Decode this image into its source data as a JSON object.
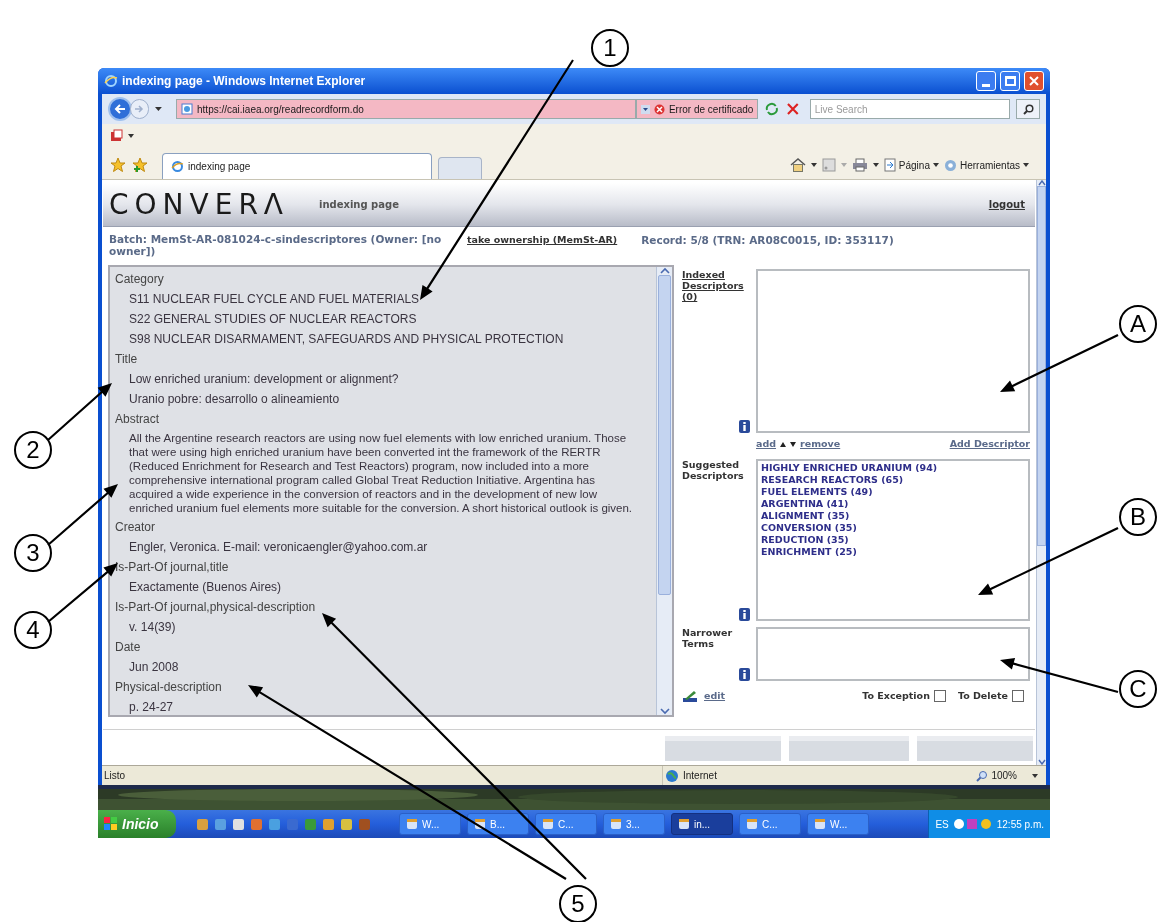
{
  "callouts": [
    {
      "label": "1"
    },
    {
      "label": "2"
    },
    {
      "label": "3"
    },
    {
      "label": "4"
    },
    {
      "label": "5"
    },
    {
      "label": "A"
    },
    {
      "label": "B"
    },
    {
      "label": "C"
    }
  ],
  "window": {
    "title": "indexing page - Windows Internet Explorer"
  },
  "address_bar": {
    "url": "https://cai.iaea.org/readrecordform.do",
    "certificate_error": "Error de certificado"
  },
  "search": {
    "placeholder": "Live Search"
  },
  "tabs": [
    {
      "label": "indexing page",
      "selected": true
    }
  ],
  "command_bar": [
    "Página",
    "Herramientas"
  ],
  "page": {
    "logo": "CONVERΛ",
    "title": "indexing page",
    "logout": "logout",
    "batch": "Batch: MemSt-AR-081024-c-sindescriptores (Owner: [no owner])",
    "take_ownership": "take ownership (MemSt-AR)",
    "record": "Record: 5/8 (TRN: AR08C0015, ID: 353117)"
  },
  "record_fields": [
    {
      "label": "Category",
      "values": [
        "S11 NUCLEAR FUEL CYCLE AND FUEL MATERIALS",
        "S22 GENERAL STUDIES OF NUCLEAR REACTORS",
        "S98 NUCLEAR DISARMAMENT, SAFEGUARDS AND PHYSICAL PROTECTION"
      ]
    },
    {
      "label": "Title",
      "values": [
        "Low enriched uranium: development or alignment?",
        "Uranio pobre: desarrollo o alineamiento"
      ]
    },
    {
      "label": "Abstract",
      "kind": "paragraph",
      "values": [
        "All the Argentine research reactors are using now fuel elements with low enriched uranium. Those that were using high enriched uranium have been converted int the framework of the RERTR (Reduced Enrichment for Research and Test Reactors) program, now included into a more comprehensive international program called Global Treat Reduction Initiative. Argentina has acquired a wide experience in the conversion of reactors and in the development of new low enriched uranium fuel elements more suitable for the conversion. A short historical outlook is given."
      ]
    },
    {
      "label": "Creator",
      "values": [
        "Engler, Veronica. E-mail: veronicaengler@yahoo.com.ar"
      ]
    },
    {
      "label": "Is-Part-Of journal,title",
      "values": [
        "Exactamente (Buenos Aires)"
      ]
    },
    {
      "label": "Is-Part-Of journal,physical-description",
      "values": [
        "v. 14(39)"
      ]
    },
    {
      "label": "Date",
      "values": [
        "Jun 2008"
      ]
    },
    {
      "label": "Physical-description",
      "values": [
        "p. 24-27"
      ]
    }
  ],
  "indexed_descriptors": {
    "label": "Indexed Descriptors (0)",
    "add": "add",
    "remove": "remove",
    "add_descriptor": "Add Descriptor"
  },
  "suggested_descriptors": {
    "label": "Suggested Descriptors",
    "items": [
      "HIGHLY ENRICHED URANIUM (94)",
      "RESEARCH REACTORS (65)",
      "FUEL ELEMENTS (49)",
      "ARGENTINA (41)",
      "ALIGNMENT (35)",
      "CONVERSION (35)",
      "REDUCTION (35)",
      "ENRICHMENT (25)"
    ]
  },
  "narrower_terms": {
    "label": "Narrower Terms"
  },
  "edit": "edit",
  "flags": [
    {
      "label": "To Exception",
      "checked": false
    },
    {
      "label": "To Delete",
      "checked": false
    }
  ],
  "status_bar": {
    "text": "Listo",
    "zone": "Internet",
    "zoom": "100%"
  },
  "taskbar": {
    "start": "Inicio",
    "tasks": [
      {
        "label": "W...",
        "selected": false
      },
      {
        "label": "B...",
        "selected": false
      },
      {
        "label": "C...",
        "selected": false
      },
      {
        "label": "3...",
        "selected": false
      },
      {
        "label": "in...",
        "selected": true
      },
      {
        "label": "C...",
        "selected": false
      },
      {
        "label": "W...",
        "selected": false
      }
    ],
    "language": "ES",
    "clock": "12:55 p.m."
  }
}
